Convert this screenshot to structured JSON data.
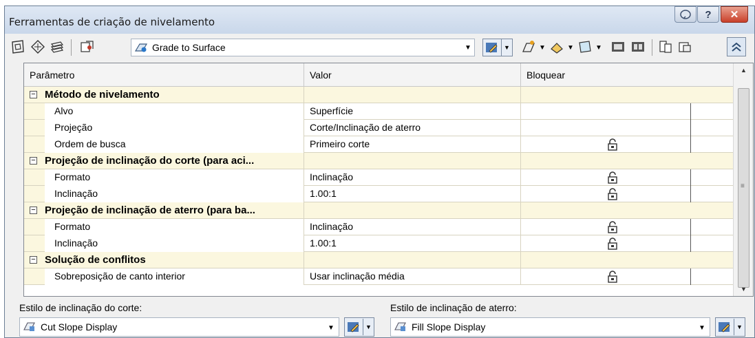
{
  "window": {
    "title": "Ferramentas de criação de nivelamento"
  },
  "toolbar": {
    "criteria_selected": "Grade to Surface"
  },
  "grid": {
    "headers": [
      "Parâmetro",
      "Valor",
      "Bloquear"
    ],
    "rows": [
      {
        "type": "category",
        "label": "Método de nivelamento",
        "value": ""
      },
      {
        "type": "item",
        "label": "Alvo",
        "value": "Superfície",
        "locked": false
      },
      {
        "type": "item",
        "label": "Projeção",
        "value": "Corte/Inclinação de aterro",
        "locked": false
      },
      {
        "type": "item",
        "label": "Ordem de busca",
        "value": "Primeiro corte",
        "locked": true
      },
      {
        "type": "category",
        "label": "Projeção de inclinação do corte (para aci...",
        "value": ""
      },
      {
        "type": "item",
        "label": "Formato",
        "value": "Inclinação",
        "locked": true
      },
      {
        "type": "item",
        "label": "Inclinação",
        "value": "1.00:1",
        "locked": true
      },
      {
        "type": "category",
        "label": "Projeção de inclinação de aterro (para ba...",
        "value": ""
      },
      {
        "type": "item",
        "label": "Formato",
        "value": "Inclinação",
        "locked": true
      },
      {
        "type": "item",
        "label": "Inclinação",
        "value": "1.00:1",
        "locked": true
      },
      {
        "type": "category",
        "label": "Solução de conflitos",
        "value": ""
      },
      {
        "type": "item",
        "label": "Sobreposição de canto interior",
        "value": "Usar inclinação média",
        "locked": true
      }
    ]
  },
  "bottom": {
    "cut_label": "Estilo de inclinação do corte:",
    "cut_value": "Cut Slope Display",
    "fill_label": "Estilo de inclinação de aterro:",
    "fill_value": "Fill Slope Display"
  },
  "colors": {
    "category_bg": "#fbf7df",
    "titlebar": "#c9d7ea",
    "close_button": "#c9402a"
  }
}
